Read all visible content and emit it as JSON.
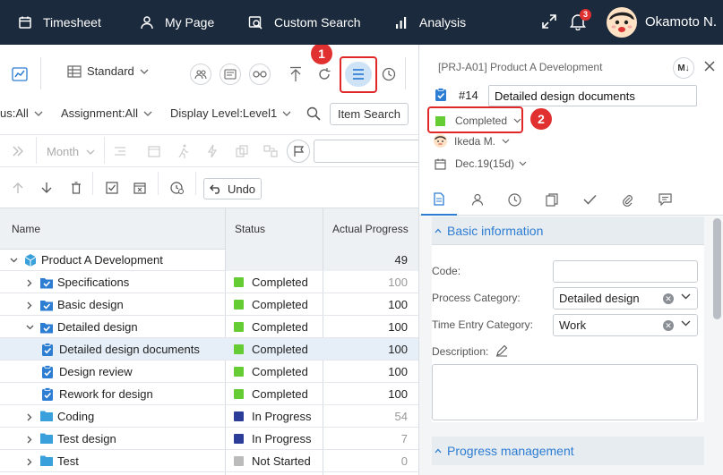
{
  "topbar": {
    "nav": [
      {
        "label": "Timesheet",
        "icon": "calendar-icon"
      },
      {
        "label": "My Page",
        "icon": "person-icon"
      },
      {
        "label": "Custom Search",
        "icon": "search-doc-icon"
      },
      {
        "label": "Analysis",
        "icon": "bar-chart-icon"
      }
    ],
    "notification_count": "3",
    "user_name": "Okamoto N."
  },
  "toolbar": {
    "view_label": "Standard",
    "filters": [
      {
        "label": "us:All"
      },
      {
        "label": "Assignment:All"
      },
      {
        "label": "Display Level:Level1"
      }
    ],
    "item_search_label": "Item Search",
    "period_label": "Month",
    "undo_label": "Undo"
  },
  "callouts": {
    "one": "1",
    "two": "2"
  },
  "table": {
    "headers": {
      "name": "Name",
      "status": "Status",
      "progress": "Actual Progress"
    },
    "rows": [
      {
        "name": "Product A Development",
        "status": "",
        "progress": "49",
        "level": 0,
        "type": "project",
        "expander": "down",
        "muted": false
      },
      {
        "name": "Specifications",
        "status": "Completed",
        "status_color": "#66cc33",
        "progress": "100",
        "level": 1,
        "type": "task-group",
        "expander": "right",
        "muted": true
      },
      {
        "name": "Basic design",
        "status": "Completed",
        "status_color": "#66cc33",
        "progress": "100",
        "level": 1,
        "type": "task-group",
        "expander": "right",
        "muted": false
      },
      {
        "name": "Detailed design",
        "status": "Completed",
        "status_color": "#66cc33",
        "progress": "100",
        "level": 1,
        "type": "task-group",
        "expander": "down",
        "muted": false
      },
      {
        "name": "Detailed design documents",
        "status": "Completed",
        "status_color": "#66cc33",
        "progress": "100",
        "level": 2,
        "type": "task",
        "expander": "",
        "muted": false,
        "selected": true
      },
      {
        "name": "Design review",
        "status": "Completed",
        "status_color": "#66cc33",
        "progress": "100",
        "level": 2,
        "type": "task",
        "expander": "",
        "muted": false
      },
      {
        "name": "Rework for design",
        "status": "Completed",
        "status_color": "#66cc33",
        "progress": "100",
        "level": 2,
        "type": "task",
        "expander": "",
        "muted": false
      },
      {
        "name": "Coding",
        "status": "In Progress",
        "status_color": "#2b3d99",
        "progress": "54",
        "level": 1,
        "type": "folder",
        "expander": "right",
        "muted": true
      },
      {
        "name": "Test design",
        "status": "In Progress",
        "status_color": "#2b3d99",
        "progress": "7",
        "level": 1,
        "type": "folder",
        "expander": "right",
        "muted": true
      },
      {
        "name": "Test",
        "status": "Not Started",
        "status_color": "#bbbbbb",
        "progress": "0",
        "level": 1,
        "type": "folder",
        "expander": "right",
        "muted": true
      }
    ]
  },
  "detail": {
    "breadcrumb": "[PRJ-A01] Product A Development",
    "markdown_badge": "M↓",
    "task_number": "#14",
    "task_title": "Detailed design documents",
    "status": "Completed",
    "status_color": "#66cc33",
    "assignee": "Ikeda M.",
    "due_date": "Dec.19(15d)",
    "section_basic": "Basic information",
    "section_progress": "Progress management",
    "form": {
      "code_label": "Code:",
      "code_value": "",
      "process_label": "Process Category:",
      "process_value": "Detailed design",
      "time_label": "Time Entry Category:",
      "time_value": "Work",
      "desc_label": "Description:",
      "desc_value": ""
    }
  },
  "colors": {
    "topbar": "#1b2a3c",
    "accent": "#2d7dd2",
    "callout": "#e03030"
  }
}
